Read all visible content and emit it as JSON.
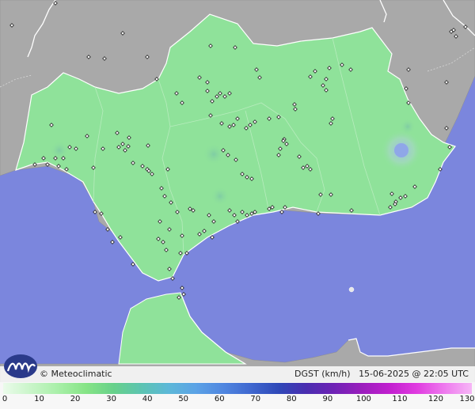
{
  "brand": {
    "name": "Meteoclimatic",
    "symbol": "©"
  },
  "info": {
    "variable": "DGST (km/h)",
    "datetime": "15-06-2025 @ 22:05 UTC"
  },
  "legend": {
    "ticks": [
      "0",
      "10",
      "20",
      "30",
      "40",
      "50",
      "60",
      "70",
      "80",
      "90",
      "100",
      "110",
      "120",
      "130"
    ],
    "colors": [
      "#eafbea",
      "#c9f5c9",
      "#a8efa8",
      "#86e486",
      "#67d18a",
      "#5cc4b1",
      "#5cb8d8",
      "#5ba2e6",
      "#4f86e0",
      "#3f67cf",
      "#2f48b8",
      "#4a2db0",
      "#6e22b5",
      "#9a1ebd",
      "#c11fcf",
      "#e03be0",
      "#ee7aee",
      "#f6b6f6"
    ],
    "max": 130
  },
  "map": {
    "sea_color": "#7b86dd",
    "land_color": "#9bc9a0",
    "region_color": "#8fe29a",
    "foreign_land_color": "#a8a8a8",
    "hotspot_color": "#8fa7e8"
  }
}
